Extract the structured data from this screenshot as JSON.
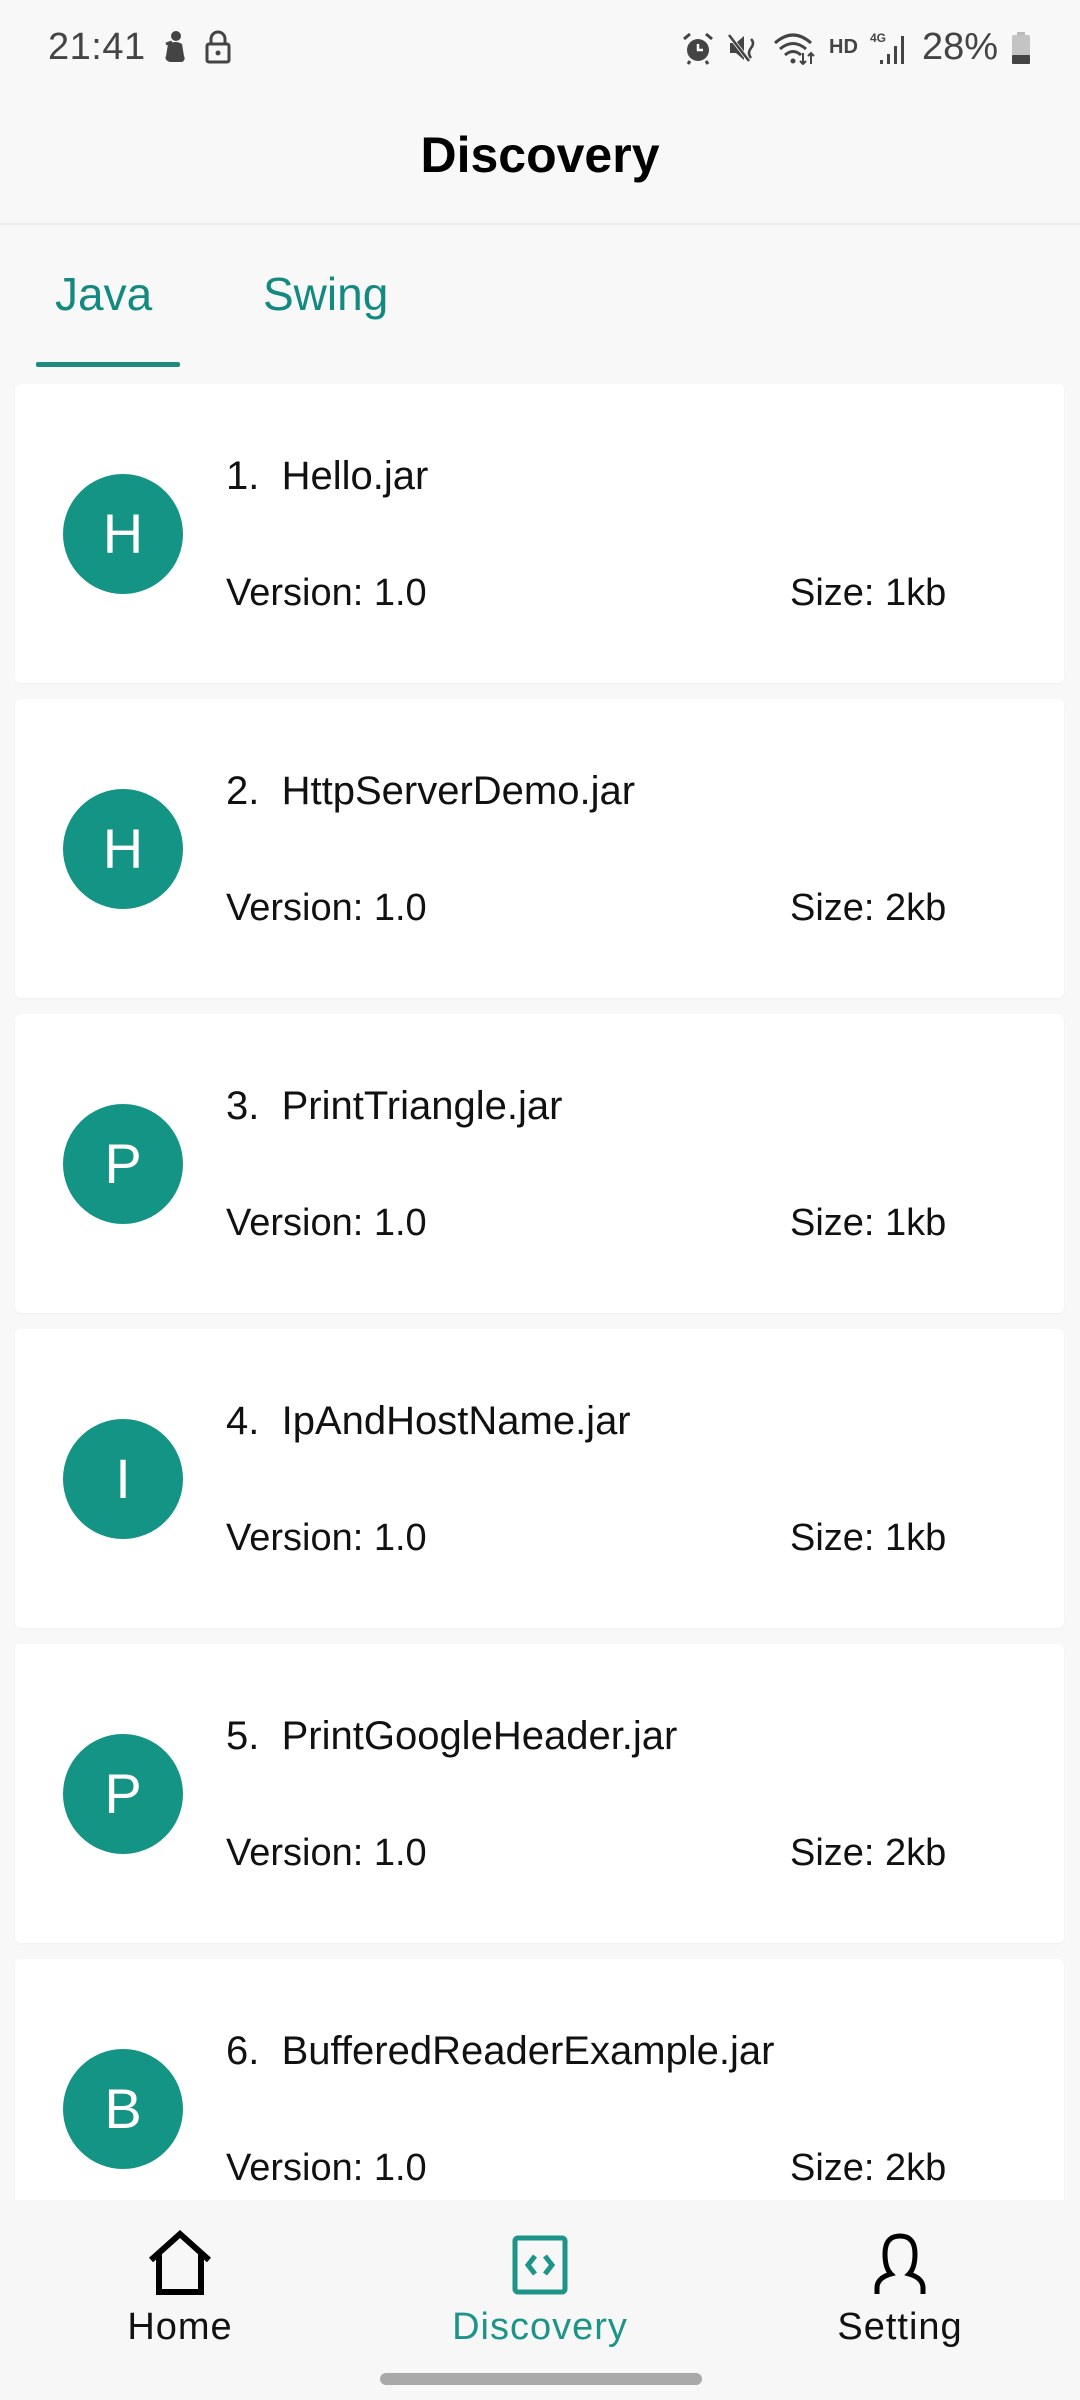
{
  "status_bar": {
    "time": "21:41",
    "left_icons": [
      "notification-figure-icon",
      "lock-icon"
    ],
    "right_icons": [
      "alarm-icon",
      "mute-icon",
      "wifi-icon",
      "hd-icon",
      "signal-4g-icon",
      "battery-icon"
    ],
    "hd_label": "HD",
    "network_label": "4G",
    "battery_percent": "28%"
  },
  "app_bar": {
    "title": "Discovery"
  },
  "tabs": [
    {
      "label": "Java",
      "selected": true
    },
    {
      "label": "Swing",
      "selected": false
    }
  ],
  "colors": {
    "accent": "#138a80",
    "avatar": "#139485",
    "card_bg": "#ffffff",
    "page_bg": "#f8f8f8"
  },
  "items": [
    {
      "initial": "H",
      "title": "1.  Hello.jar",
      "version": "Version: 1.0",
      "size": "Size: 1kb"
    },
    {
      "initial": "H",
      "title": "2.  HttpServerDemo.jar",
      "version": "Version: 1.0",
      "size": "Size: 2kb"
    },
    {
      "initial": "P",
      "title": "3.  PrintTriangle.jar",
      "version": "Version: 1.0",
      "size": "Size: 1kb"
    },
    {
      "initial": "I",
      "title": "4.  IpAndHostName.jar",
      "version": "Version: 1.0",
      "size": "Size: 1kb"
    },
    {
      "initial": "P",
      "title": "5.  PrintGoogleHeader.jar",
      "version": "Version: 1.0",
      "size": "Size: 2kb"
    },
    {
      "initial": "B",
      "title": "6.  BufferedReaderExample.jar",
      "version": "Version: 1.0",
      "size": "Size: 2kb"
    }
  ],
  "bottom_nav": [
    {
      "label": "Home",
      "icon": "home-icon",
      "active": false
    },
    {
      "label": "Discovery",
      "icon": "code-icon",
      "active": true
    },
    {
      "label": "Setting",
      "icon": "person-icon",
      "active": false
    }
  ]
}
